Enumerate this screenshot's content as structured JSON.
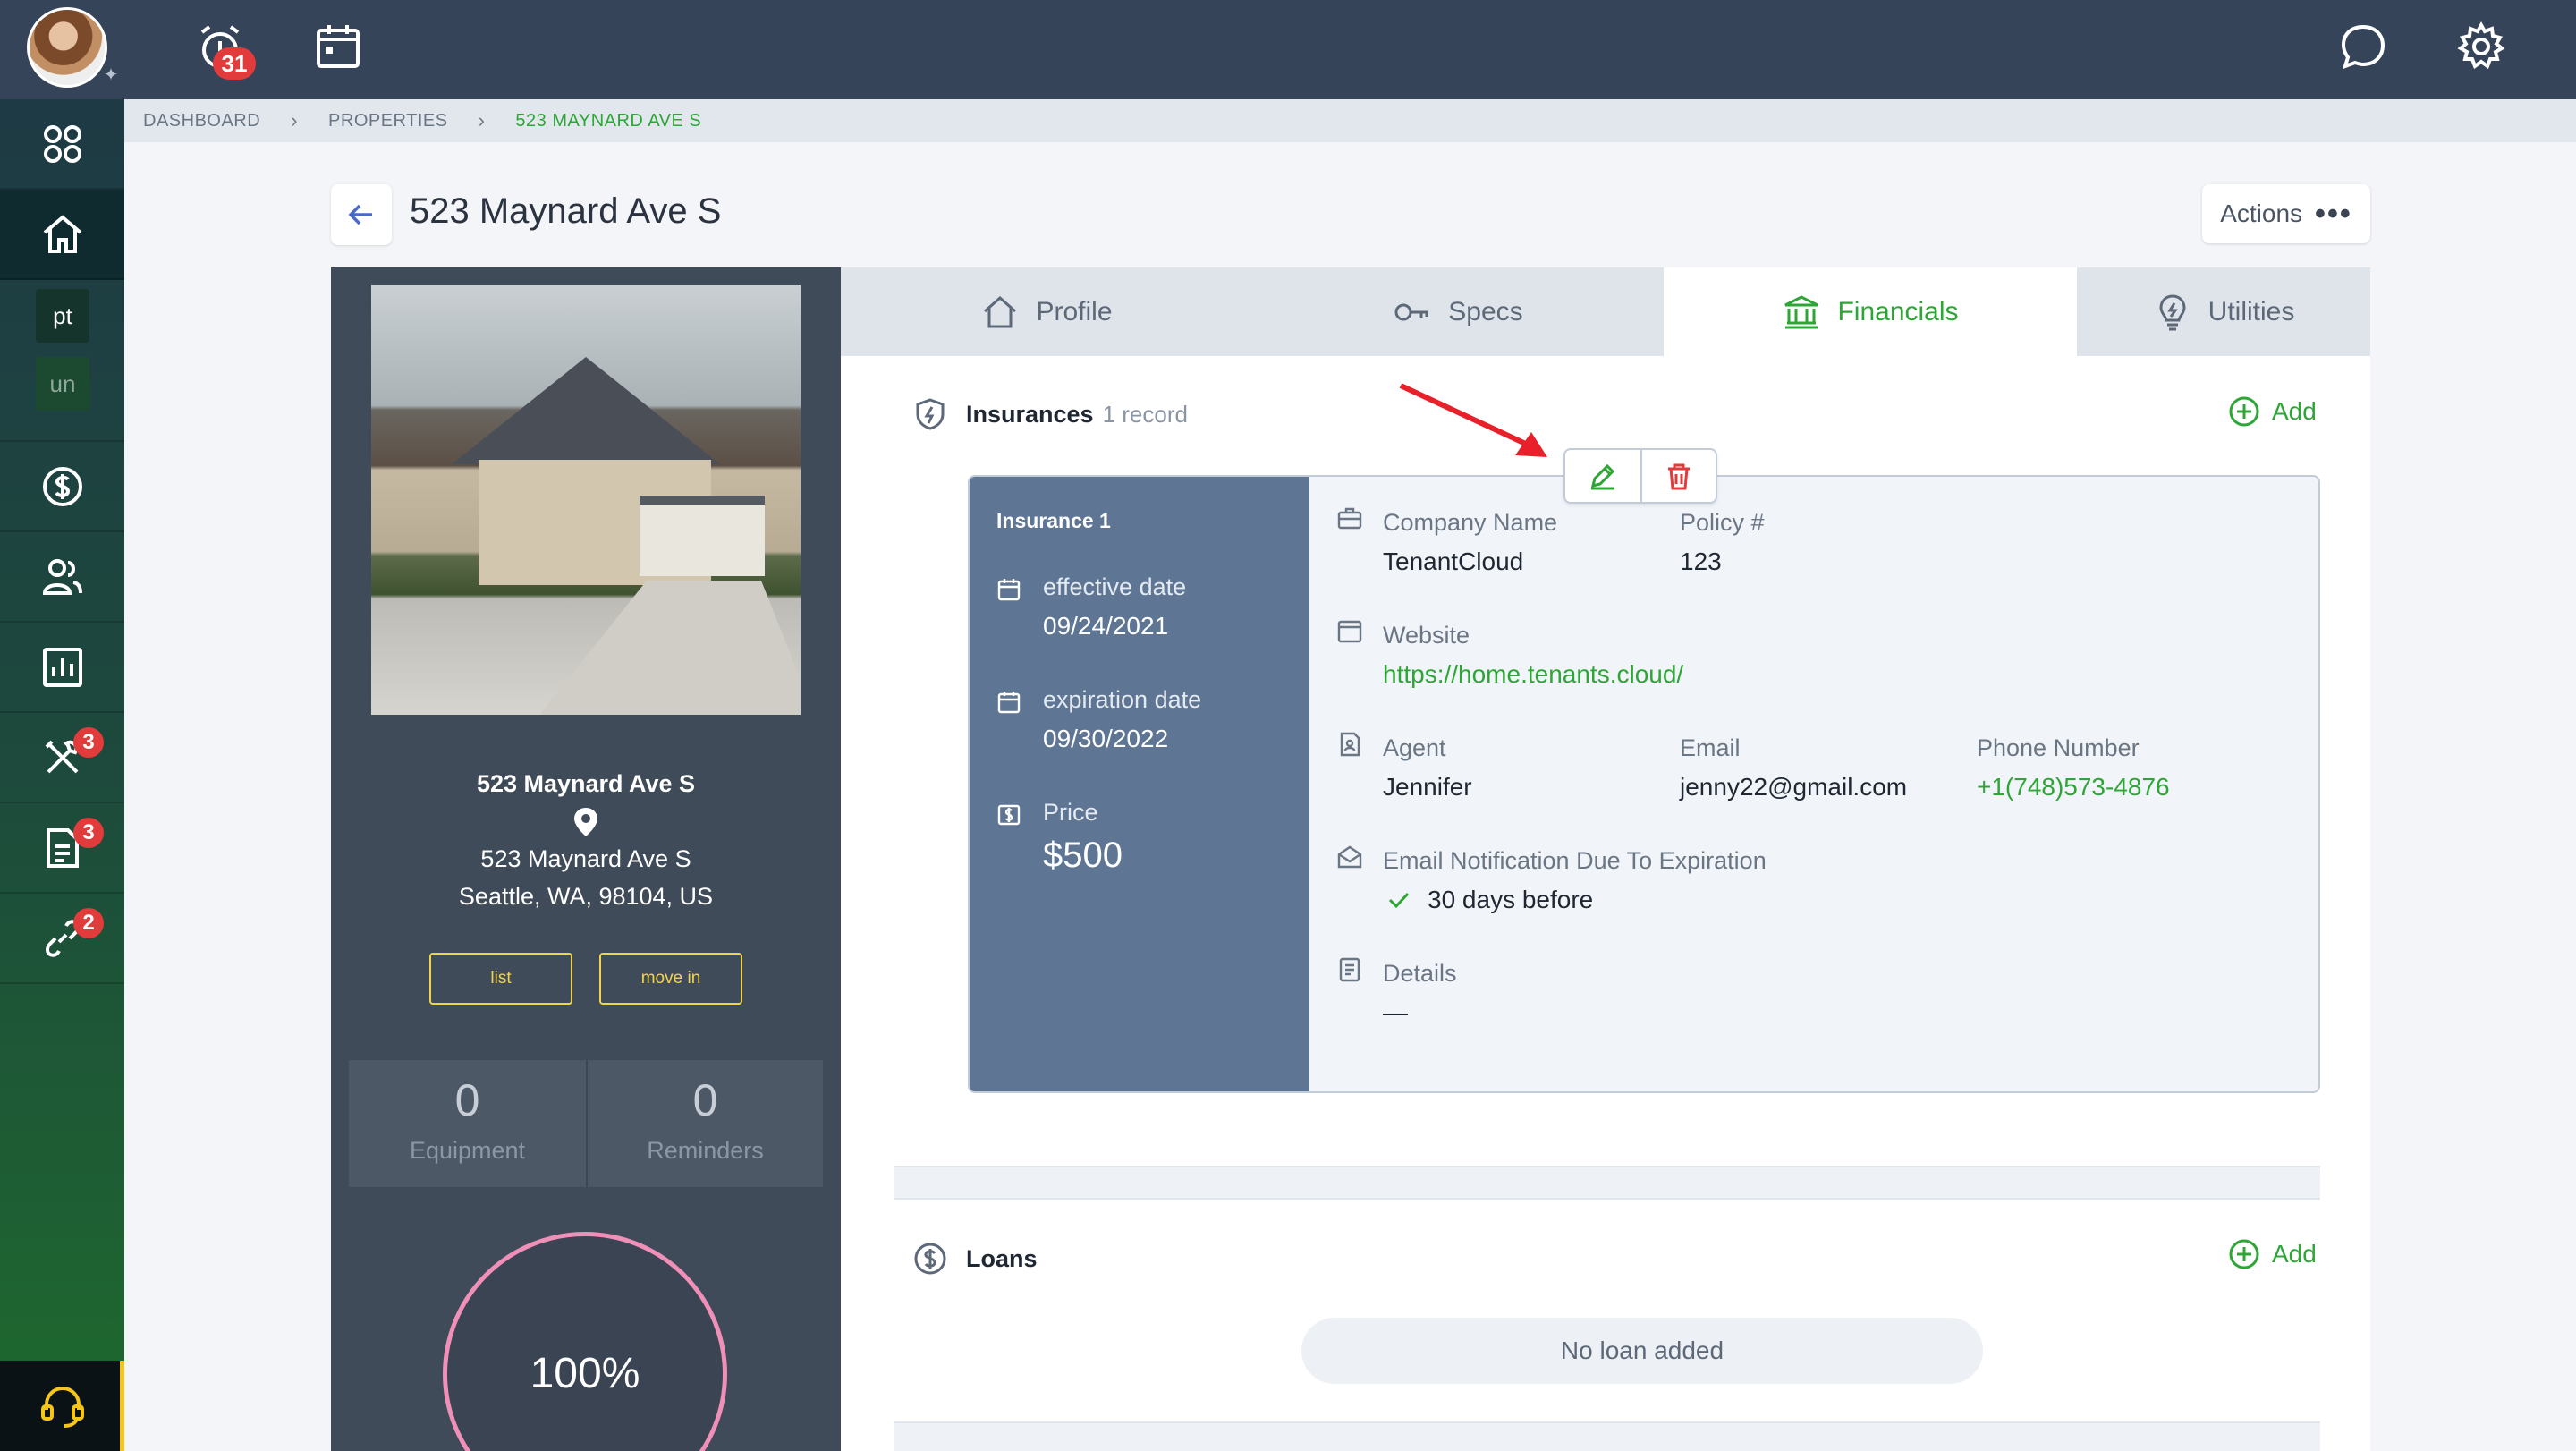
{
  "topbar": {
    "notification_count": "31",
    "icons": [
      "alarm-clock-icon",
      "calendar-icon",
      "chat-bubble-icon",
      "gear-icon"
    ]
  },
  "sidebar": {
    "items": [
      {
        "icon": "apps-grid-icon"
      },
      {
        "icon": "home-icon",
        "active": true
      },
      {
        "abbr": "pt"
      },
      {
        "abbr": "un"
      },
      {
        "icon": "dollar-circle-icon"
      },
      {
        "icon": "people-icon"
      },
      {
        "icon": "bar-chart-icon"
      },
      {
        "icon": "tools-icon",
        "badge": "3"
      },
      {
        "icon": "document-icon",
        "badge": "3"
      },
      {
        "icon": "link-icon",
        "badge": "2"
      }
    ],
    "support_icon": "headset-icon"
  },
  "breadcrumb": {
    "items": [
      "DASHBOARD",
      "PROPERTIES",
      "523 MAYNARD AVE S"
    ]
  },
  "header": {
    "title": "523 Maynard Ave S",
    "actions_label": "Actions"
  },
  "property": {
    "name": "523 Maynard Ave S",
    "address_line1": "523 Maynard Ave S",
    "address_line2": "Seattle, WA, 98104, US",
    "list_label": "list",
    "move_in_label": "move in",
    "equipment_count": "0",
    "equipment_label": "Equipment",
    "reminders_count": "0",
    "reminders_label": "Reminders",
    "completion": "100%"
  },
  "tabs": [
    {
      "label": "Profile",
      "icon": "house-outline-icon"
    },
    {
      "label": "Specs",
      "icon": "key-icon"
    },
    {
      "label": "Financials",
      "icon": "bank-icon",
      "active": true
    },
    {
      "label": "Utilities",
      "icon": "lightbulb-icon"
    }
  ],
  "insurances": {
    "title": "Insurances",
    "count_label": "1 record",
    "add_label": "Add",
    "record": {
      "title": "Insurance 1",
      "effective_label": "effective date",
      "effective_value": "09/24/2021",
      "expiration_label": "expiration date",
      "expiration_value": "09/30/2022",
      "price_label": "Price",
      "price_value": "$500",
      "company_label": "Company Name",
      "company_value": "TenantCloud",
      "policy_label": "Policy #",
      "policy_value": "123",
      "website_label": "Website",
      "website_value": "https://home.tenants.cloud/",
      "agent_label": "Agent",
      "agent_value": "Jennifer",
      "email_label": "Email",
      "email_value": "jenny22@gmail.com",
      "phone_label": "Phone Number",
      "phone_value": "+1(748)573-4876",
      "notify_label": "Email Notification Due To Expiration",
      "notify_value": "30 days before",
      "details_label": "Details",
      "details_value": "—"
    }
  },
  "loans": {
    "title": "Loans",
    "add_label": "Add",
    "empty_label": "No loan added"
  },
  "colors": {
    "accent_green": "#2ea636",
    "topbar": "#354459",
    "danger": "#e23b3b",
    "insurance_panel": "#5e7593",
    "button_yellow": "#f2d44a",
    "ring_pink": "#f08fb8"
  }
}
